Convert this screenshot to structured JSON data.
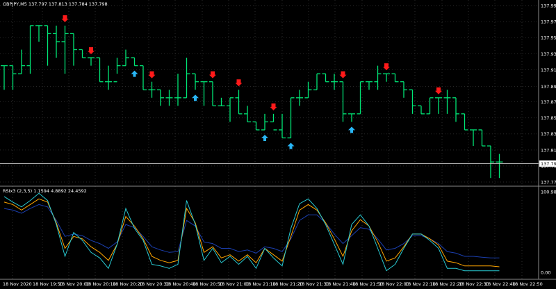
{
  "colors": {
    "background": "#000000",
    "grid": "#2b2b2b",
    "up_bar": "#00e676",
    "sell_arrow": "#ff1a1a",
    "buy_arrow": "#29b6f6",
    "rsi_fast": "#28c8d0",
    "rsi_mid": "#ffa500",
    "rsi_slow": "#1b3fb0",
    "axis_text": "#ffffff",
    "price_line": "#c8c8c8"
  },
  "main_chart": {
    "header": "GBPJPY,M5  137.797 137.813 137.784 137.798",
    "price_levels": [
      "137.995",
      "137.975",
      "137.955",
      "137.935",
      "137.915",
      "137.894",
      "137.875",
      "137.855",
      "137.835",
      "137.815",
      "137.795",
      "137.775"
    ],
    "current_price_label": "137.798",
    "sell_arrow_icon": "arrow-down-icon",
    "buy_arrow_icon": "arrow-up-icon"
  },
  "rsi_panel": {
    "header": "RSIx3 (2,3,5) 1.1594 4.8892 24.4592",
    "level_max": "100.98",
    "level_min": "0.00"
  },
  "time_axis": {
    "labels": [
      "18 Nov 2020",
      "18 Nov 19:50",
      "18 Nov 20:00",
      "18 Nov 20:10",
      "18 Nov 20:20",
      "18 Nov 20:30",
      "18 Nov 20:40",
      "18 Nov 20:50",
      "18 Nov 21:00",
      "18 Nov 21:10",
      "18 Nov 21:20",
      "18 Nov 21:30",
      "18 Nov 21:40",
      "18 Nov 21:50",
      "18 Nov 22:00",
      "18 Nov 22:10",
      "18 Nov 22:20",
      "18 Nov 22:30",
      "18 Nov 22:40",
      "18 Nov 22:50"
    ]
  },
  "chart_data": {
    "type": "ohlc",
    "x_step_minutes": 5,
    "bars": [
      {
        "o": 137.92,
        "h": 137.92,
        "l": 137.89,
        "c": 137.92
      },
      {
        "o": 137.92,
        "h": 137.92,
        "l": 137.89,
        "c": 137.91
      },
      {
        "o": 137.91,
        "h": 137.94,
        "l": 137.91,
        "c": 137.92
      },
      {
        "o": 137.92,
        "h": 137.97,
        "l": 137.91,
        "c": 137.97
      },
      {
        "o": 137.97,
        "h": 137.97,
        "l": 137.95,
        "c": 137.97
      },
      {
        "o": 137.97,
        "h": 137.97,
        "l": 137.92,
        "c": 137.96
      },
      {
        "o": 137.96,
        "h": 137.97,
        "l": 137.93,
        "c": 137.95
      },
      {
        "o": 137.95,
        "h": 137.97,
        "l": 137.91,
        "c": 137.96
      },
      {
        "o": 137.96,
        "h": 137.96,
        "l": 137.92,
        "c": 137.94
      },
      {
        "o": 137.94,
        "h": 137.94,
        "l": 137.93,
        "c": 137.93
      },
      {
        "o": 137.93,
        "h": 137.93,
        "l": 137.92,
        "c": 137.93
      },
      {
        "o": 137.93,
        "h": 137.93,
        "l": 137.9,
        "c": 137.9
      },
      {
        "o": 137.9,
        "h": 137.92,
        "l": 137.89,
        "c": 137.9
      },
      {
        "o": 137.9,
        "h": 137.93,
        "l": 137.91,
        "c": 137.92
      },
      {
        "o": 137.92,
        "h": 137.94,
        "l": 137.92,
        "c": 137.93
      },
      {
        "o": 137.93,
        "h": 137.93,
        "l": 137.92,
        "c": 137.92
      },
      {
        "o": 137.92,
        "h": 137.92,
        "l": 137.89,
        "c": 137.89
      },
      {
        "o": 137.89,
        "h": 137.9,
        "l": 137.88,
        "c": 137.89
      },
      {
        "o": 137.89,
        "h": 137.89,
        "l": 137.87,
        "c": 137.88
      },
      {
        "o": 137.88,
        "h": 137.89,
        "l": 137.87,
        "c": 137.88
      },
      {
        "o": 137.88,
        "h": 137.91,
        "l": 137.87,
        "c": 137.88
      },
      {
        "o": 137.88,
        "h": 137.93,
        "l": 137.88,
        "c": 137.91
      },
      {
        "o": 137.91,
        "h": 137.91,
        "l": 137.89,
        "c": 137.9
      },
      {
        "o": 137.9,
        "h": 137.9,
        "l": 137.87,
        "c": 137.9
      },
      {
        "o": 137.9,
        "h": 137.9,
        "l": 137.87,
        "c": 137.87
      },
      {
        "o": 137.87,
        "h": 137.88,
        "l": 137.87,
        "c": 137.87
      },
      {
        "o": 137.87,
        "h": 137.88,
        "l": 137.85,
        "c": 137.88
      },
      {
        "o": 137.88,
        "h": 137.89,
        "l": 137.86,
        "c": 137.86
      },
      {
        "o": 137.86,
        "h": 137.87,
        "l": 137.85,
        "c": 137.85
      },
      {
        "o": 137.85,
        "h": 137.85,
        "l": 137.84,
        "c": 137.84
      },
      {
        "o": 137.84,
        "h": 137.86,
        "l": 137.84,
        "c": 137.85
      },
      {
        "o": 137.85,
        "h": 137.86,
        "l": 137.85,
        "c": 137.84
      },
      {
        "o": 137.84,
        "h": 137.86,
        "l": 137.83,
        "c": 137.83
      },
      {
        "o": 137.83,
        "h": 137.88,
        "l": 137.83,
        "c": 137.88
      },
      {
        "o": 137.88,
        "h": 137.89,
        "l": 137.87,
        "c": 137.88
      },
      {
        "o": 137.88,
        "h": 137.9,
        "l": 137.88,
        "c": 137.89
      },
      {
        "o": 137.89,
        "h": 137.91,
        "l": 137.89,
        "c": 137.91
      },
      {
        "o": 137.91,
        "h": 137.91,
        "l": 137.9,
        "c": 137.9
      },
      {
        "o": 137.9,
        "h": 137.91,
        "l": 137.89,
        "c": 137.9
      },
      {
        "o": 137.9,
        "h": 137.9,
        "l": 137.85,
        "c": 137.86
      },
      {
        "o": 137.86,
        "h": 137.86,
        "l": 137.85,
        "c": 137.86
      },
      {
        "o": 137.86,
        "h": 137.9,
        "l": 137.86,
        "c": 137.9
      },
      {
        "o": 137.9,
        "h": 137.9,
        "l": 137.89,
        "c": 137.9
      },
      {
        "o": 137.9,
        "h": 137.92,
        "l": 137.89,
        "c": 137.91
      },
      {
        "o": 137.91,
        "h": 137.91,
        "l": 137.9,
        "c": 137.91
      },
      {
        "o": 137.91,
        "h": 137.91,
        "l": 137.9,
        "c": 137.9
      },
      {
        "o": 137.9,
        "h": 137.9,
        "l": 137.88,
        "c": 137.89
      },
      {
        "o": 137.89,
        "h": 137.89,
        "l": 137.86,
        "c": 137.87
      },
      {
        "o": 137.87,
        "h": 137.87,
        "l": 137.86,
        "c": 137.86
      },
      {
        "o": 137.86,
        "h": 137.88,
        "l": 137.86,
        "c": 137.88
      },
      {
        "o": 137.88,
        "h": 137.88,
        "l": 137.86,
        "c": 137.88
      },
      {
        "o": 137.88,
        "h": 137.89,
        "l": 137.86,
        "c": 137.88
      },
      {
        "o": 137.88,
        "h": 137.88,
        "l": 137.85,
        "c": 137.86
      },
      {
        "o": 137.86,
        "h": 137.86,
        "l": 137.84,
        "c": 137.84
      },
      {
        "o": 137.84,
        "h": 137.84,
        "l": 137.82,
        "c": 137.84
      },
      {
        "o": 137.84,
        "h": 137.84,
        "l": 137.82,
        "c": 137.82
      },
      {
        "o": 137.82,
        "h": 137.82,
        "l": 137.78,
        "c": 137.8
      },
      {
        "o": 137.8,
        "h": 137.81,
        "l": 137.78,
        "c": 137.8
      }
    ],
    "sell_signals": [
      7,
      10,
      17,
      24,
      27,
      31,
      39,
      44,
      50
    ],
    "buy_signals": [
      15,
      22,
      30,
      33,
      40
    ],
    "rsi": {
      "title": "RSIx3 (2,3,5) 1.1594 4.8892 24.4592",
      "ylim": [
        0,
        100.98
      ],
      "series": [
        {
          "name": "RSI 2",
          "values": [
            95,
            88,
            82,
            90,
            99,
            90,
            60,
            20,
            50,
            40,
            25,
            18,
            5,
            35,
            80,
            55,
            40,
            10,
            8,
            5,
            10,
            90,
            60,
            15,
            30,
            12,
            20,
            10,
            20,
            5,
            30,
            18,
            8,
            55,
            86,
            92,
            80,
            60,
            35,
            10,
            60,
            72,
            58,
            30,
            2,
            10,
            30,
            48,
            48,
            40,
            30,
            5,
            5,
            2,
            2,
            2,
            2,
            2
          ]
        },
        {
          "name": "RSI 3",
          "values": [
            88,
            85,
            78,
            85,
            92,
            88,
            62,
            30,
            45,
            42,
            32,
            25,
            15,
            35,
            70,
            58,
            42,
            20,
            15,
            12,
            15,
            80,
            62,
            25,
            32,
            18,
            22,
            14,
            22,
            12,
            30,
            22,
            14,
            45,
            78,
            85,
            78,
            62,
            42,
            20,
            52,
            66,
            58,
            38,
            14,
            18,
            32,
            48,
            48,
            42,
            34,
            14,
            12,
            8,
            8,
            8,
            8,
            7
          ]
        },
        {
          "name": "RSI 5",
          "values": [
            80,
            78,
            74,
            80,
            85,
            82,
            65,
            45,
            48,
            46,
            40,
            36,
            30,
            38,
            60,
            56,
            45,
            32,
            28,
            25,
            26,
            65,
            58,
            38,
            36,
            30,
            30,
            26,
            28,
            24,
            32,
            30,
            26,
            42,
            65,
            72,
            72,
            62,
            48,
            36,
            46,
            56,
            54,
            42,
            28,
            30,
            36,
            46,
            46,
            42,
            36,
            26,
            24,
            20,
            20,
            19,
            18,
            18
          ]
        }
      ]
    }
  }
}
